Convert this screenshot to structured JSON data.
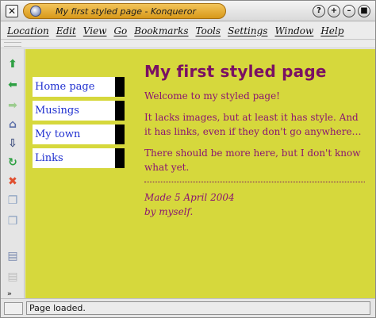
{
  "window": {
    "title": "My first styled page - Konqueror",
    "close_glyph": "✕",
    "title_buttons": [
      "?",
      "+",
      "–",
      "■"
    ]
  },
  "menubar": {
    "items": [
      "Location",
      "Edit",
      "View",
      "Go",
      "Bookmarks",
      "Tools",
      "Settings",
      "Window",
      "Help"
    ]
  },
  "toolbar": {
    "tools": [
      {
        "name": "up-arrow-icon",
        "glyph": "⬆",
        "color": "#2ea043"
      },
      {
        "name": "back-arrow-icon",
        "glyph": "⬅",
        "color": "#2ea043"
      },
      {
        "name": "forward-arrow-icon",
        "glyph": "➡",
        "color": "#9ccc8f"
      },
      {
        "name": "home-icon",
        "glyph": "⌂",
        "color": "#5b6fa8"
      },
      {
        "name": "history-icon",
        "glyph": "⇩",
        "color": "#3f4f7f"
      },
      {
        "name": "reload-icon",
        "glyph": "↻",
        "color": "#2ea043"
      },
      {
        "name": "stop-icon",
        "glyph": "✖",
        "color": "#e05030"
      },
      {
        "name": "copy-icon",
        "glyph": "❐",
        "color": "#8aa0c0"
      },
      {
        "name": "paste-icon",
        "glyph": "❐",
        "color": "#8aa0c0"
      },
      {
        "name": "print-icon",
        "glyph": "▤",
        "color": "#7a8ab0"
      },
      {
        "name": "print-frame-icon",
        "glyph": "▤",
        "color": "#bcbcbc"
      }
    ],
    "more": "»"
  },
  "page": {
    "nav": [
      "Home page",
      "Musings",
      "My town",
      "Links"
    ],
    "title": "My first styled page",
    "paragraphs": [
      "Welcome to my styled page!",
      "It lacks images, but at least it has style. And it has links, even if they don't go anywhere…",
      "There should be more here, but I don't know what yet."
    ],
    "address_line1": "Made 5 April 2004",
    "address_line2": "by myself."
  },
  "status": {
    "text": "Page loaded."
  },
  "colors": {
    "page_bg": "#d6d83c",
    "heading": "#7a1063",
    "text": "#8a1571",
    "link": "#1f2fd0",
    "title_pill": "#e3a928"
  }
}
